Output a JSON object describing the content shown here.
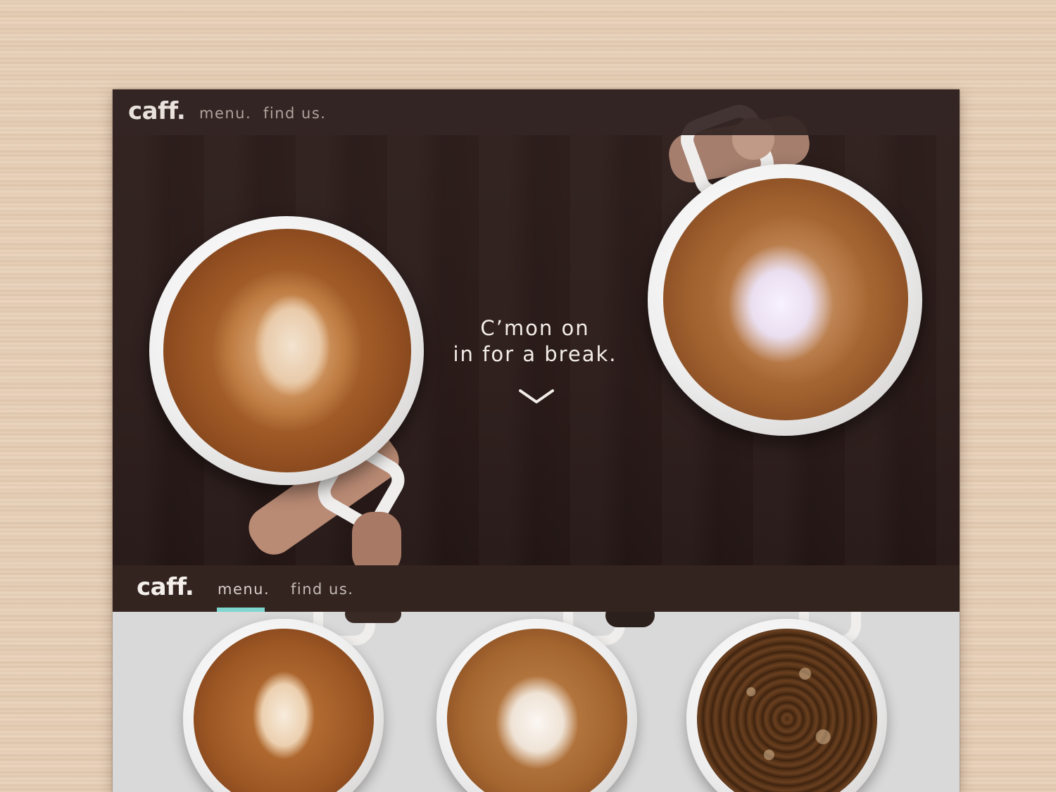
{
  "brand": {
    "logo": "caff."
  },
  "nav": {
    "menu_label": "menu.",
    "find_label": "find us."
  },
  "hero": {
    "tagline_line1": "C’mon on",
    "tagline_line2": "in for a break.",
    "scroll_icon": "chevron-down-icon"
  },
  "second_nav": {
    "logo": "caff.",
    "menu_label": "menu.",
    "find_label": "find us.",
    "active_item": "menu."
  },
  "colors": {
    "accent": "#7fd6cf",
    "nav_bg": "#33241f",
    "hero_bg": "#2b1c1a",
    "section_bg": "#d9d9d9",
    "wood": "#e7cfb6"
  },
  "products": [
    {
      "name": "latte-cup-image"
    },
    {
      "name": "cappuccino-cup-image"
    },
    {
      "name": "americano-cup-image"
    }
  ]
}
